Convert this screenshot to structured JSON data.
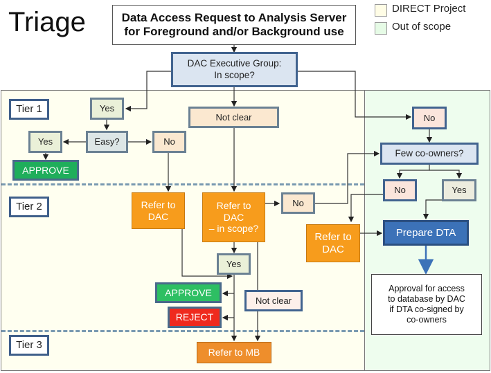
{
  "title": "Triage",
  "request": {
    "line1": "Data Access Request to Analysis Server",
    "line2": "for Foreground and/or Background use"
  },
  "legend": [
    {
      "label": "DIRECT Project",
      "color": "#fffde6"
    },
    {
      "label": "Out of scope",
      "color": "#e6fbe6"
    }
  ],
  "tiers": [
    "Tier 1",
    "Tier 2",
    "Tier 3"
  ],
  "nodes": {
    "dac_exec": {
      "line1": "DAC Executive Group:",
      "line2": "In scope?"
    },
    "t1_yes": "Yes",
    "t1_not_clear": "Not clear",
    "t1_no_out": "No",
    "easy": "Easy?",
    "easy_yes": "Yes",
    "easy_no": "No",
    "approve_tier1": "APPROVE",
    "few_coowners": "Few co-owners?",
    "few_no": "No",
    "few_yes": "Yes",
    "refer_dac_left": {
      "line1": "Refer to",
      "line2": "DAC"
    },
    "refer_dac_scope": {
      "line1": "Refer to",
      "line2": "DAC",
      "line3": "– in scope?"
    },
    "scope_no": "No",
    "refer_dac_right": {
      "line1": "Refer to",
      "line2": "DAC"
    },
    "prepare_dta": "Prepare DTA",
    "scope_yes": "Yes",
    "approve_tier2": "APPROVE",
    "reject": "REJECT",
    "not_clear_tier2": "Not clear",
    "approval_note": {
      "line1": "Approval for access",
      "line2": "to database by DAC",
      "line3": "if DTA co-signed by",
      "line4": "co-owners"
    },
    "refer_mb": "Refer to MB"
  }
}
